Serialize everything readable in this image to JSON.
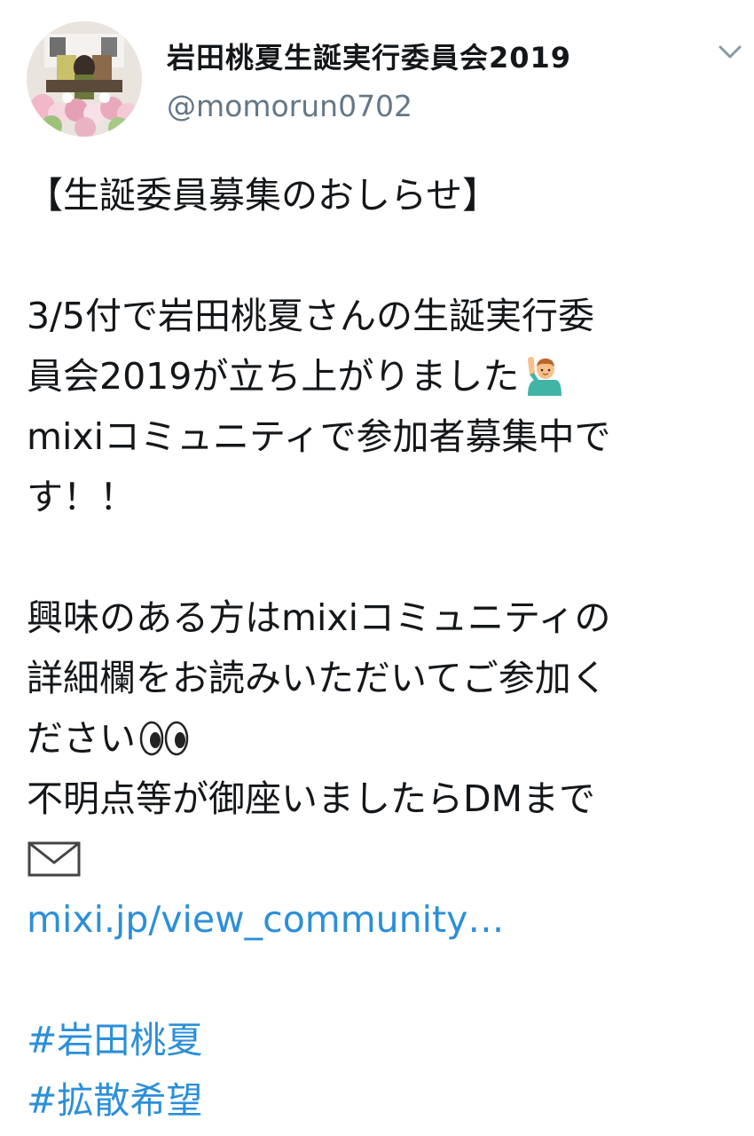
{
  "header": {
    "display_name": "岩田桃夏生誕実行委員会2019",
    "handle": "@momorun0702",
    "avatar_icon": "avatar-photo",
    "menu_icon": "chevron-down-icon"
  },
  "tweet": {
    "title_line": "【生誕委員募集のおしらせ】",
    "para1": {
      "line1": "3/5付で岩田桃夏さんの生誕実行委",
      "line2": "員会2019が立ち上がりました",
      "line2_emoji": "person-raising-hand-icon",
      "line3": "mixiコミュニティで参加者募集中で",
      "line4": "す！！"
    },
    "para2": {
      "line1": "興味のある方はmixiコミュニティの",
      "line2": "詳細欄をお読みいただいてご参加く",
      "line3": "ださい",
      "line3_emoji": "eyes-icon",
      "line4": "不明点等が御座いましたらDMまで",
      "line5_emoji": "envelope-icon"
    },
    "link": "mixi.jp/view_community…",
    "hashtags": [
      "#岩田桃夏",
      "#拡散希望"
    ]
  },
  "colors": {
    "text": "#14171a",
    "secondary": "#657786",
    "link": "#2b8fd9"
  }
}
